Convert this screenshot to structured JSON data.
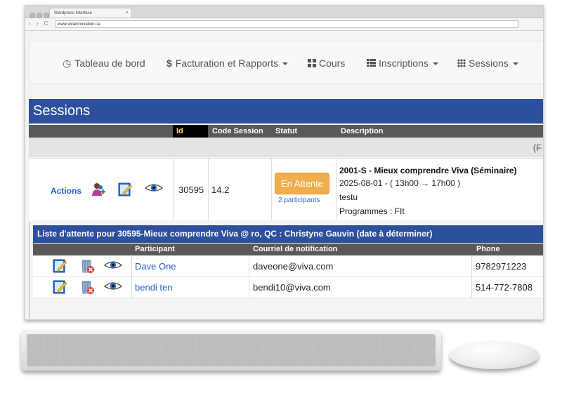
{
  "browser": {
    "tab_title": "Wordpress Interface",
    "tab_close": "×",
    "nav_buttons": "‹ › C",
    "url": "www.vivainnovation.ca"
  },
  "nav": {
    "items": [
      {
        "label": "Tableau de bord",
        "icon": "dashboard-icon",
        "dropdown": false
      },
      {
        "label": "Facturation et Rapports",
        "icon": "dollar-icon",
        "dropdown": true
      },
      {
        "label": "Cours",
        "icon": "grid-icon",
        "dropdown": false
      },
      {
        "label": "Inscriptions",
        "icon": "list-icon",
        "dropdown": true
      },
      {
        "label": "Sessions",
        "icon": "apps-icon",
        "dropdown": true
      }
    ],
    "dollar_glyph": "$",
    "dashboard_glyph": "◷"
  },
  "sessions": {
    "title": "Sessions",
    "columns": {
      "id": "Id",
      "code": "Code Session",
      "status": "Statut",
      "description": "Description"
    },
    "filter_fragment": "(F",
    "row": {
      "actions_label": "Actions",
      "id": "30595",
      "code": "14.2",
      "status": "En Attente",
      "participants": "2 participants",
      "desc_title": "2001-S - Mieux comprendre Viva (Séminaire)",
      "desc_date": "2025-08-01 - ( 13h00 → 17h00 )",
      "desc_location": "testu",
      "desc_programs": "Programmes : FIt"
    }
  },
  "waitlist": {
    "title": "Liste d'attente pour 30595-Mieux comprendre Viva @ ro, QC : Christyne Gauvin (date à déterminer)",
    "columns": {
      "participant": "Participant",
      "email": "Courriel de notification",
      "phone": "Phone"
    },
    "rows": [
      {
        "name": "Dave One",
        "email": "daveone@viva.com",
        "phone": "9782971223"
      },
      {
        "name": "bendi ten",
        "email": "bendi10@viva.com",
        "phone": "514-772-7808"
      }
    ]
  },
  "colors": {
    "primary_blue": "#2c4f9e",
    "header_gray": "#595959",
    "status_orange": "#f0ad4e",
    "link_blue": "#1f5fc7"
  }
}
